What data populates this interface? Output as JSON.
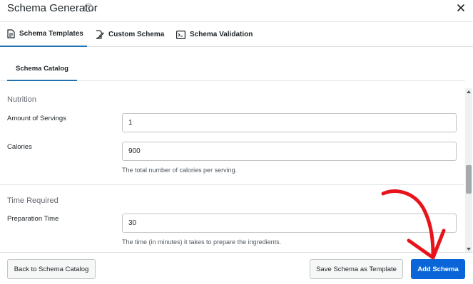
{
  "header": {
    "title": "Schema Generator",
    "help_icon": "?"
  },
  "tabs": [
    {
      "label": "Schema Templates",
      "icon": "document-icon",
      "active": true
    },
    {
      "label": "Custom Schema",
      "icon": "edit-document-icon",
      "active": false
    },
    {
      "label": "Schema Validation",
      "icon": "terminal-icon",
      "active": false
    }
  ],
  "subtabs": [
    {
      "label": "Schema Catalog",
      "active": true
    }
  ],
  "sections": {
    "nutrition": {
      "title": "Nutrition",
      "servings_label": "Amount of Servings",
      "servings_value": "1",
      "calories_label": "Calories",
      "calories_value": "900",
      "calories_help": "The total number of calories per serving."
    },
    "time": {
      "title": "Time Required",
      "prep_label": "Preparation Time",
      "prep_value": "30",
      "prep_help": "The time (in minutes) it takes to prepare the ingredients."
    }
  },
  "footer": {
    "back_label": "Back to Schema Catalog",
    "save_label": "Save Schema as Template",
    "add_label": "Add Schema"
  },
  "colors": {
    "accent": "#2271b1",
    "primary_button": "#0a66d8",
    "annotation_arrow": "#e8141c"
  }
}
